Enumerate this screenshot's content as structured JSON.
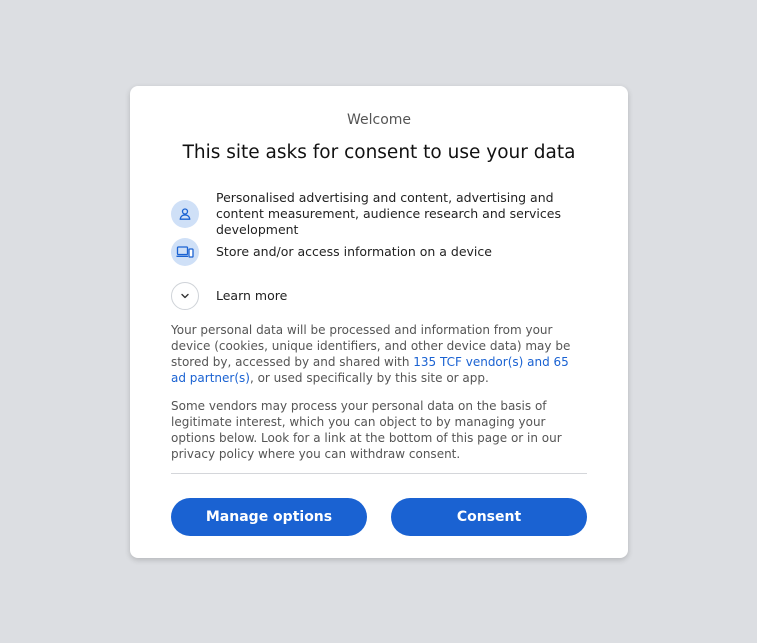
{
  "dialog": {
    "welcome": "Welcome",
    "title": "This site asks for consent to use your data"
  },
  "purposes": [
    {
      "icon": "person-icon",
      "label": "Personalised advertising and content, advertising and content measurement, audience research and services development"
    },
    {
      "icon": "devices-icon",
      "label": "Store and/or access information on a device"
    }
  ],
  "learn_more": {
    "icon": "chevron-down-icon",
    "label": "Learn more"
  },
  "paragraph1": {
    "before_link": "Your personal data will be processed and information from your device (cookies, unique identifiers, and other device data) may be stored by, accessed by and shared with ",
    "link": "135 TCF vendor(s) and 65 ad partner(s)",
    "after_link": ", or used specifically by this site or app."
  },
  "paragraph2": "Some vendors may process your personal data on the basis of legitimate interest, which you can object to by managing your options below. Look for a link at the bottom of this page or in our privacy policy where you can withdraw consent.",
  "buttons": {
    "manage": "Manage options",
    "consent": "Consent"
  },
  "colors": {
    "primary": "#1a62d2",
    "icon_bg": "#cfe0f7",
    "page_bg": "#dcdee2"
  }
}
